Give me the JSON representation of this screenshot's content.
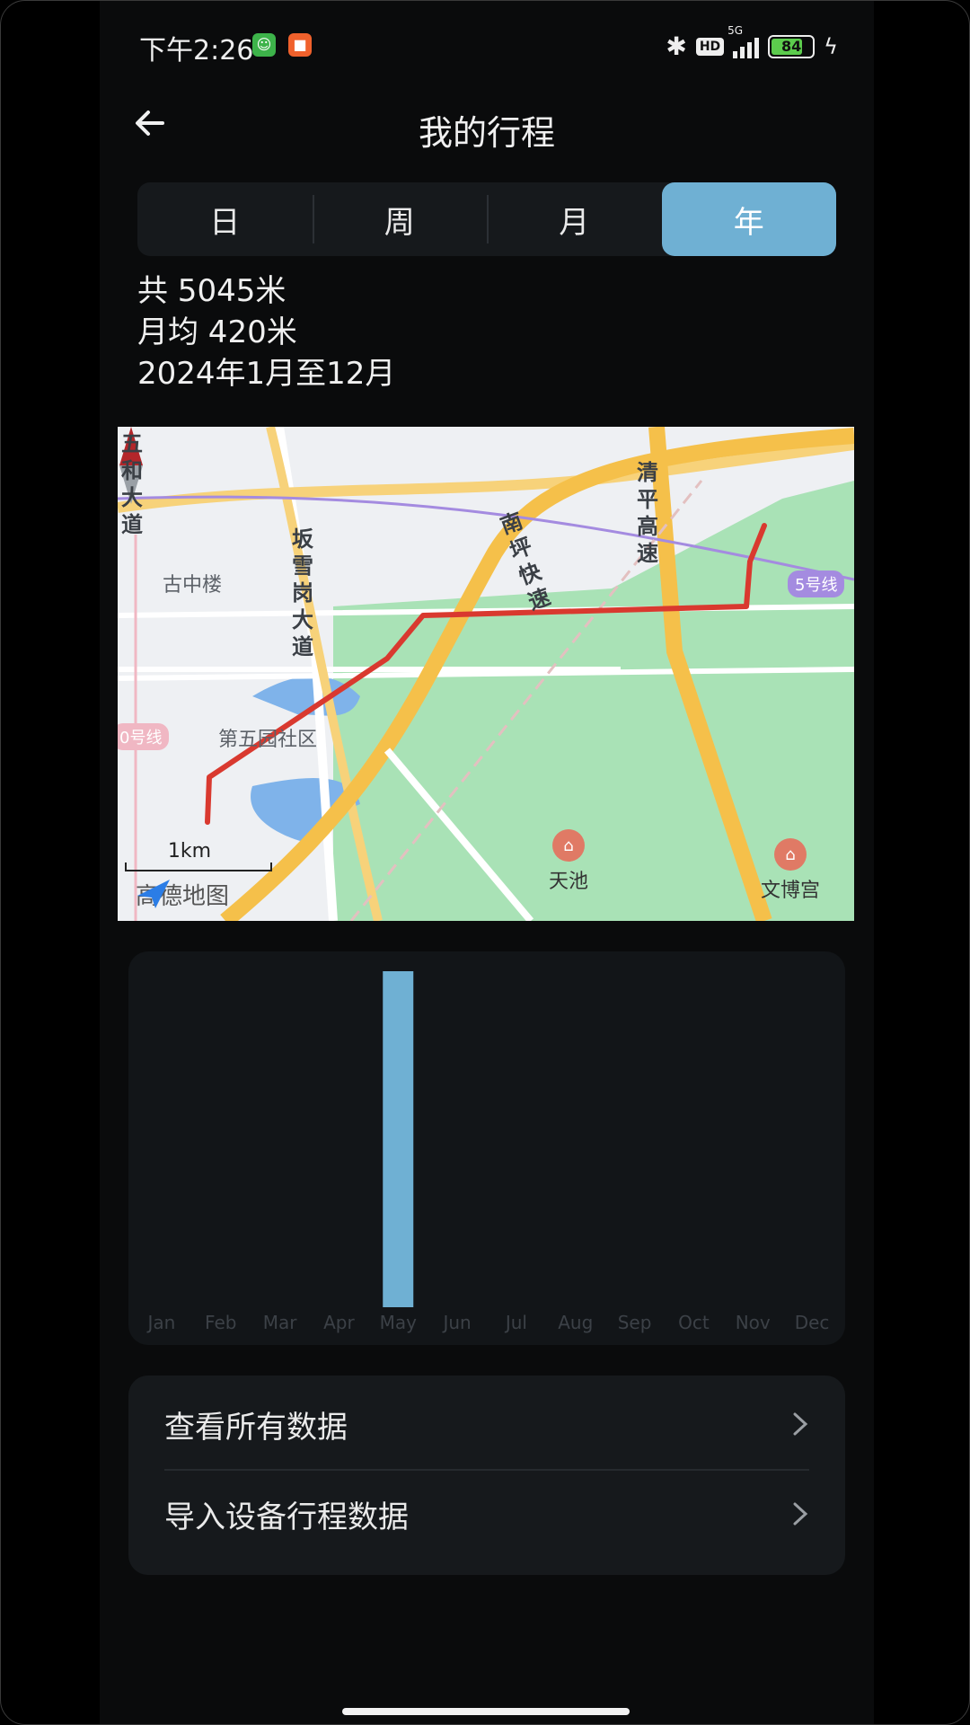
{
  "status_bar": {
    "time": "下午2:26",
    "hd_badge": "HD",
    "network": "5G",
    "battery": "84",
    "battery_level_percent": 84
  },
  "header": {
    "title": "我的行程",
    "back_icon": "arrow-left-icon"
  },
  "tabs": [
    {
      "label": "日",
      "active": false
    },
    {
      "label": "周",
      "active": false
    },
    {
      "label": "月",
      "active": false
    },
    {
      "label": "年",
      "active": true
    }
  ],
  "summary": {
    "total": "共 5045米",
    "monthly_avg": "月均 420米",
    "range": "2024年1月至12月"
  },
  "map": {
    "labels": {
      "road_wuhe": "五和大道",
      "guzhonglou": "古中楼",
      "road_banxuegang": "坂雪岗大道",
      "road_nanping": "南坪快速",
      "road_qingping": "清平高速",
      "metro_5": "5号线",
      "metro_10": "0号线",
      "community": "第五园社区",
      "poi_tianchi": "天池",
      "poi_wenbogong": "文博宫",
      "scale": "1km",
      "provider": "高德地图"
    },
    "route_color": "#d9392f"
  },
  "chart_data": {
    "type": "bar",
    "categories": [
      "Jan",
      "Feb",
      "Mar",
      "Apr",
      "May",
      "Jun",
      "Jul",
      "Aug",
      "Sep",
      "Oct",
      "Nov",
      "Dec"
    ],
    "values": [
      0,
      0,
      0,
      0,
      5045,
      0,
      0,
      0,
      0,
      0,
      0,
      0
    ],
    "ylim": [
      0,
      5045
    ],
    "color": "#6fb0d3",
    "grid": false
  },
  "list": {
    "view_all": "查看所有数据",
    "import": "导入设备行程数据"
  },
  "colors": {
    "accent": "#6fb0d3",
    "background": "#0a0b0c",
    "card": "#16191c"
  }
}
